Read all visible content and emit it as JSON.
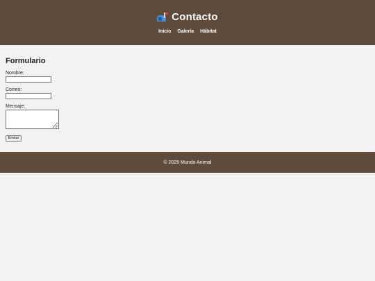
{
  "header": {
    "title": "Contacto",
    "icon": "mailbox-icon",
    "nav": [
      {
        "label": "Inicio"
      },
      {
        "label": "Galería"
      },
      {
        "label": "Hábitat"
      }
    ]
  },
  "form": {
    "title": "Formulario",
    "name_label": "Nombre:",
    "name_value": "",
    "email_label": "Correo:",
    "email_value": "",
    "message_label": "Mensaje:",
    "message_value": "",
    "submit_label": "Enviar"
  },
  "footer": {
    "text": "© 2025 Mundo Animal"
  },
  "colors": {
    "header_bg": "#5e4b3c",
    "page_bg": "#f2f2f2"
  }
}
